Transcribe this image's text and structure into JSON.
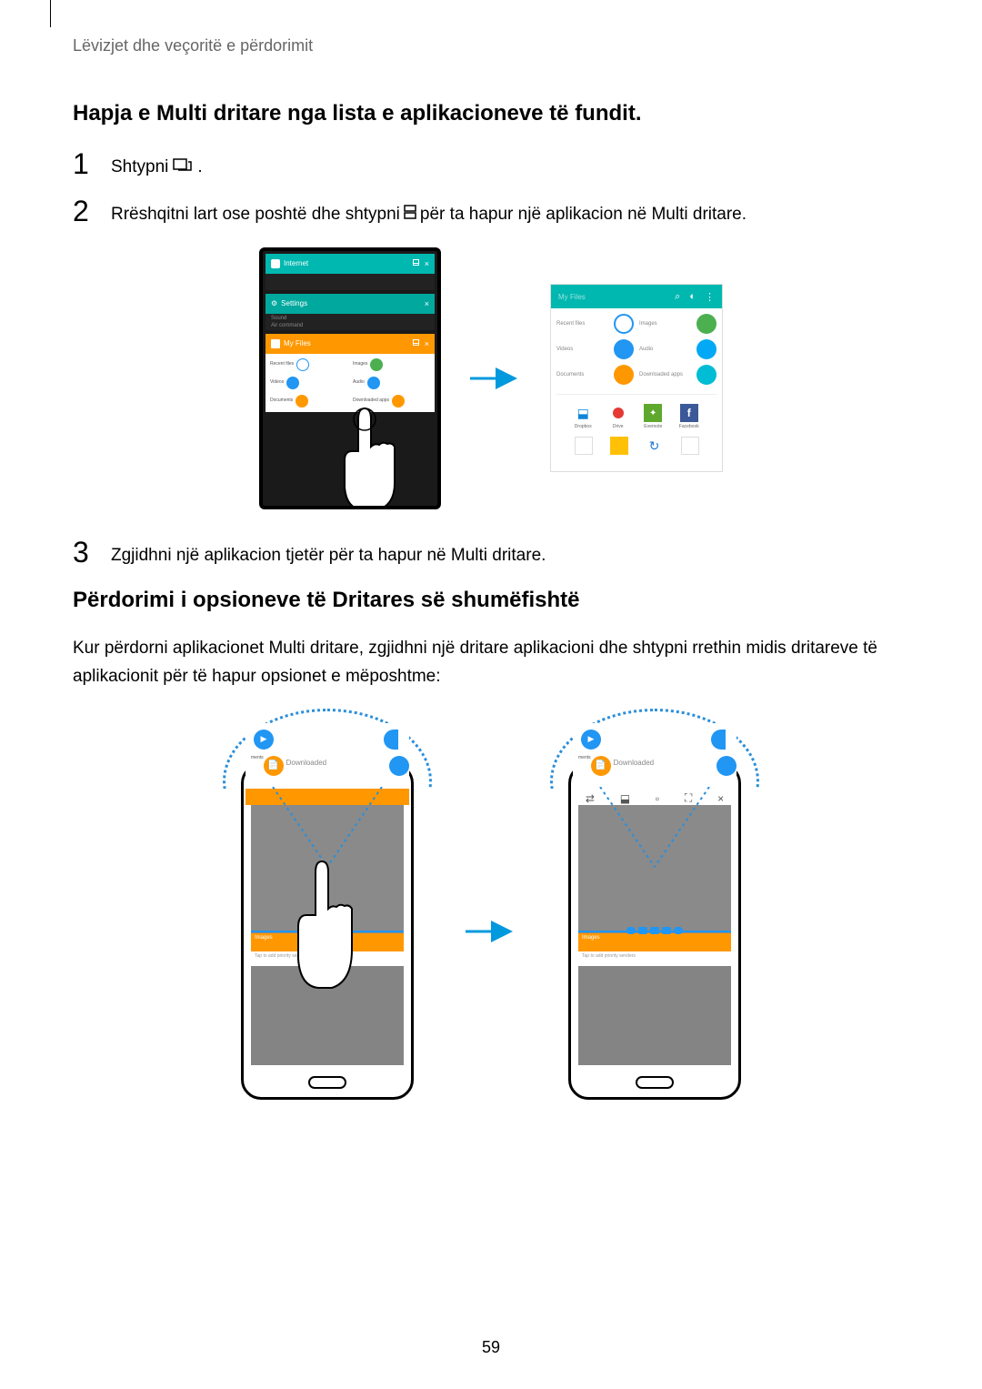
{
  "breadcrumb": "Lëvizjet dhe veçoritë e përdorimit",
  "section1": {
    "title": "Hapja e Multi dritare nga lista e aplikacioneve të fundit.",
    "step1_a": "Shtypni ",
    "step1_b": ".",
    "step2_a": "Rrëshqitni lart ose poshtë dhe shtypni ",
    "step2_b": " për ta hapur një aplikacion në Multi dritare.",
    "step3": "Zgjidhni një aplikacion tjetër për ta hapur në Multi dritare."
  },
  "section2": {
    "title": "Përdorimi i opsioneve të Dritares së shumëfishtë",
    "para": "Kur përdorni aplikacionet Multi dritare, zgjidhni një dritare aplikacioni dhe shtypni rrethin midis dritareve të aplikacionit për të hapur opsionet e mëposhtme:"
  },
  "fig1": {
    "apps": {
      "internet": "Internet",
      "settings": "Settings",
      "air": "Air command",
      "files": "My Files"
    },
    "filesHeader": "My Files",
    "gridLabels": {
      "recent": "Recent files",
      "images": "Images",
      "videos": "Videos",
      "audio": "Audio",
      "documents": "Documents",
      "downloaded": "Downloaded apps"
    },
    "appTiny": {
      "dropbox": "Dropbox",
      "drive": "Drive",
      "evernote": "Evernote",
      "facebook": "Facebook"
    }
  },
  "fig2": {
    "bubble": {
      "documents": "ments",
      "downloaded": "Downloaded"
    },
    "orangeHeader": "Images",
    "hintText": "Tap to add priority senders"
  },
  "pageNumber": "59"
}
